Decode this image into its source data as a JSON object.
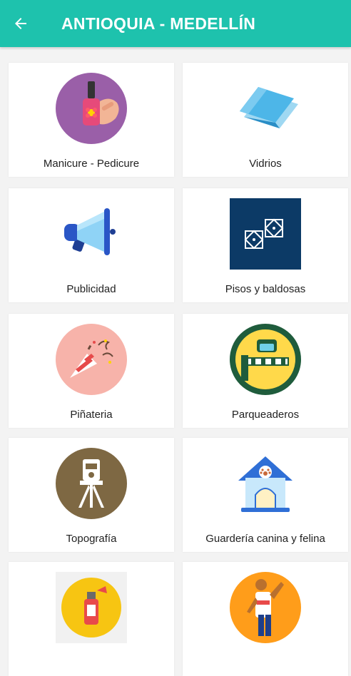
{
  "header": {
    "title": "ANTIOQUIA - MEDELLÍN",
    "back_icon": "arrow-left-icon",
    "background": "#1ec2ad"
  },
  "categories": [
    {
      "label": "Manicure - Pedicure",
      "icon": "nail-polish-icon"
    },
    {
      "label": "Vidrios",
      "icon": "glass-panes-icon"
    },
    {
      "label": "Publicidad",
      "icon": "megaphone-icon"
    },
    {
      "label": "Pisos y baldosas",
      "icon": "floor-tiles-icon"
    },
    {
      "label": "Piñateria",
      "icon": "party-popper-icon"
    },
    {
      "label": "Parqueaderos",
      "icon": "parking-barrier-icon"
    },
    {
      "label": "Topografía",
      "icon": "theodolite-icon"
    },
    {
      "label": "Guardería canina y felina",
      "icon": "pet-house-icon"
    },
    {
      "label": "",
      "icon": "spray-can-icon"
    },
    {
      "label": "",
      "icon": "person-waving-icon"
    }
  ]
}
